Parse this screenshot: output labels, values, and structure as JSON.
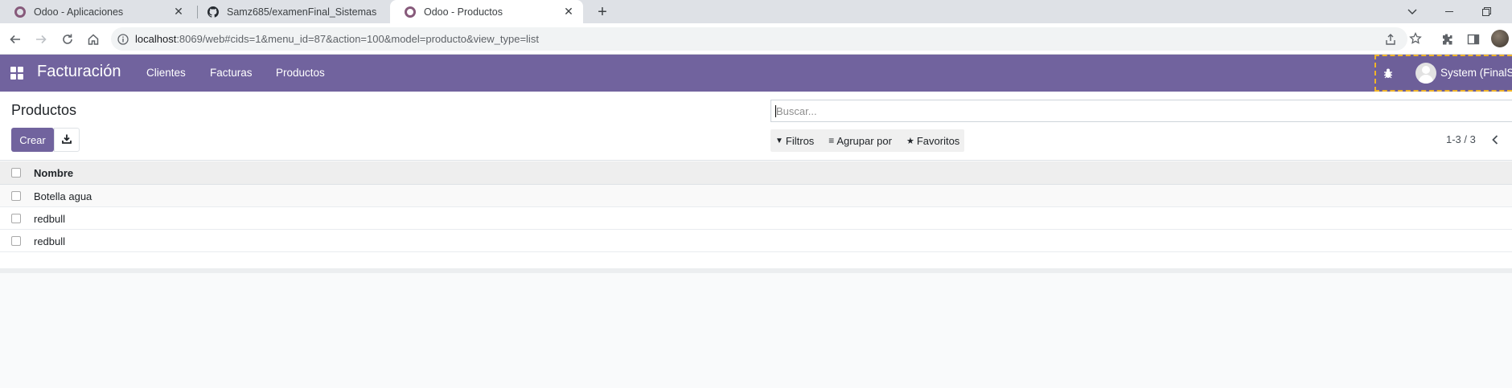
{
  "browser": {
    "tabs": [
      {
        "title": "Odoo - Aplicaciones",
        "icon": "odoo-icon"
      },
      {
        "title": "Samz685/examenFinal_Sistemas",
        "icon": "github-icon"
      },
      {
        "title": "Odoo - Productos",
        "icon": "odoo-icon",
        "active": true
      }
    ],
    "url_host": "localhost",
    "url_rest": ":8069/web#cids=1&menu_id=87&action=100&model=producto&view_type=list"
  },
  "navbar": {
    "app_name": "Facturación",
    "menu": [
      "Clientes",
      "Facturas",
      "Productos"
    ],
    "user": "System (FinalS",
    "color": "#71639e"
  },
  "control_panel": {
    "breadcrumb": "Productos",
    "create_label": "Crear",
    "search_placeholder": "Buscar...",
    "filters_label": "Filtros",
    "group_by_label": "Agrupar por",
    "favorites_label": "Favoritos",
    "pager": "1-3 / 3"
  },
  "list": {
    "column_header": "Nombre",
    "rows": [
      "Botella agua",
      "redbull",
      "redbull"
    ]
  }
}
